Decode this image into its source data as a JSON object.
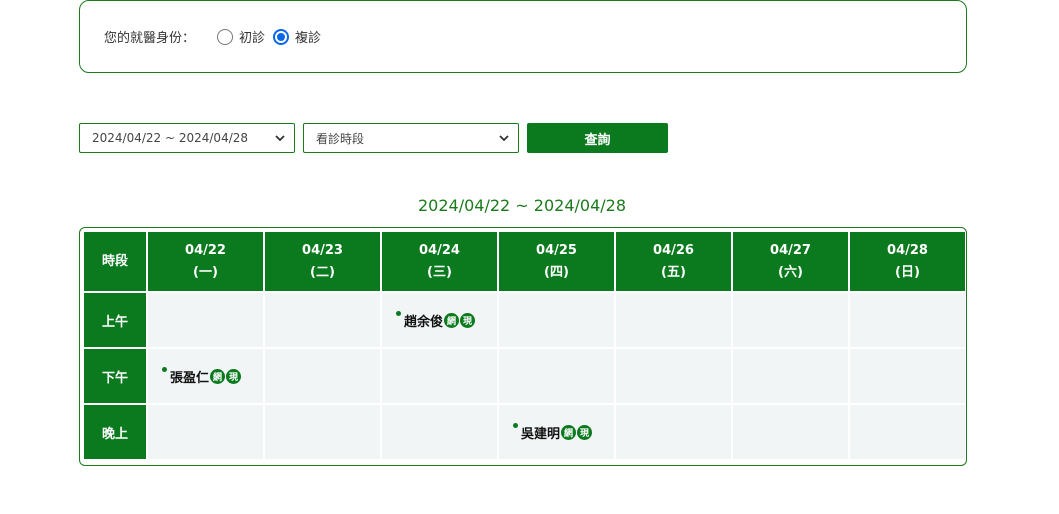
{
  "status": {
    "label": "您的就醫身份：",
    "options": [
      {
        "label": "初診",
        "checked": false
      },
      {
        "label": "複診",
        "checked": true
      }
    ]
  },
  "filters": {
    "week_value": "2024/04/22 ~ 2024/04/28",
    "period_value": "看診時段",
    "query_label": "查詢"
  },
  "schedule": {
    "title": "2024/04/22 ~ 2024/04/28",
    "period_header": "時段",
    "days": [
      {
        "date": "04/22",
        "weekday": "(一)"
      },
      {
        "date": "04/23",
        "weekday": "(二)"
      },
      {
        "date": "04/24",
        "weekday": "(三)"
      },
      {
        "date": "04/25",
        "weekday": "(四)"
      },
      {
        "date": "04/26",
        "weekday": "(五)"
      },
      {
        "date": "04/27",
        "weekday": "(六)"
      },
      {
        "date": "04/28",
        "weekday": "(日)"
      }
    ],
    "periods": [
      {
        "label": "上午",
        "doctors": [
          "",
          "",
          "趙余俊",
          "",
          "",
          "",
          ""
        ]
      },
      {
        "label": "下午",
        "doctors": [
          "張盈仁",
          "",
          "",
          "",
          "",
          "",
          ""
        ]
      },
      {
        "label": "晚上",
        "doctors": [
          "",
          "",
          "",
          "吳建明",
          "",
          "",
          ""
        ]
      }
    ],
    "badges": {
      "online": "網",
      "onsite": "現"
    }
  },
  "colors": {
    "primary": "#0b7a1e",
    "cell_bg": "#f1f5f5",
    "radio_accent": "#0a66e8"
  },
  "icons": {
    "select_arrow": "chevron-down-icon",
    "doctor_marker": "dot-icon"
  }
}
